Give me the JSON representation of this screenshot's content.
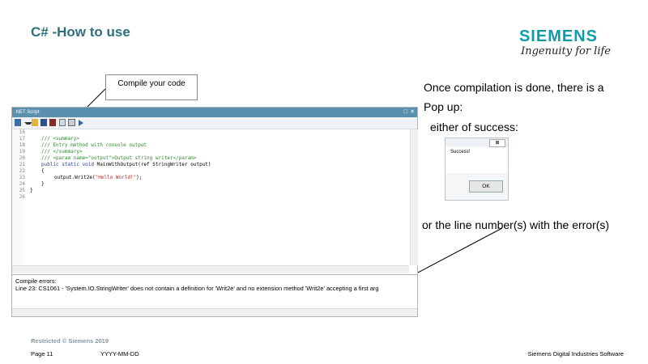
{
  "slide_title": "C# -How to use",
  "logo": {
    "brand": "SIEMENS",
    "tagline": "Ingenuity for life"
  },
  "callout_text": "Compile your code",
  "ide": {
    "title": ".NET Script",
    "window_buttons": [
      "□",
      "✕"
    ],
    "line_numbers": [
      "16",
      "17",
      "18",
      "19",
      "20",
      "21",
      "22",
      "23",
      "24",
      "25",
      "26"
    ],
    "code": {
      "l17": "/// <summary>",
      "l18": "/// Entry method with console output",
      "l19": "/// </summary>",
      "l20": "/// <param name=\"output\">Output string writer</param>",
      "l21_kw": "public static void",
      "l21_rest": " MainWithOutput(ref StringWriter output)",
      "l22": "{",
      "l23_pre": "output.Writ2e(",
      "l23_str": "\"Hello World!\"",
      "l23_post": ");",
      "l24": "}",
      "l25": "}"
    },
    "output_header": "Compile errors:",
    "output_line": "Line 23: CS1061 - 'System.IO.StringWriter' does not contain a definition for 'Writ2e' and no extension method 'Writ2e' accepting a first arg"
  },
  "right_text": {
    "line1": "Once compilation is done, there is a",
    "line2": "Pop up:",
    "line3": "either of success:",
    "line4": "or the line number(s) with the error(s)"
  },
  "dialog": {
    "message": "Success!",
    "ok_label": "OK"
  },
  "footer": {
    "restricted": "Restricted © Siemens 2019",
    "page": "Page 11",
    "date": "YYYY-MM-DD",
    "company": "Siemens Digital Industries Software"
  },
  "colors": {
    "title": "#2f6f7e",
    "brand": "#0b9ea8",
    "ide_titlebar": "#5a8fae",
    "comment": "#2b8c2b",
    "keyword": "#1f3fa8",
    "string": "#d02020"
  }
}
